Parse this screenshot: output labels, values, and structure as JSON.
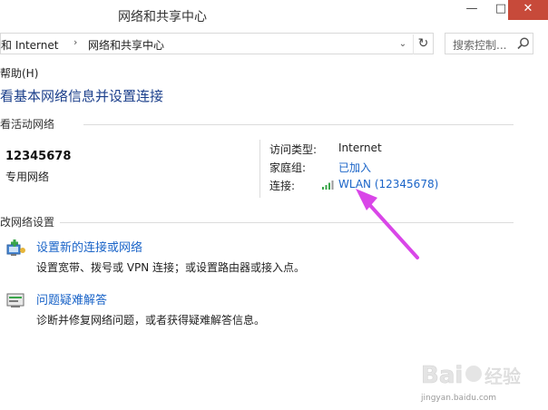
{
  "window": {
    "title": "网络和共享中心",
    "minimize": "—",
    "maximize": "□",
    "close": "✕"
  },
  "address": {
    "crumbs": [
      "和 Internet",
      "网络和共享中心"
    ],
    "separator": "›",
    "dropdown": "⌄",
    "refresh": "↻"
  },
  "search": {
    "placeholder": "搜索控制..."
  },
  "menu": {
    "help": "帮助(H)"
  },
  "heading": "看基本网络信息并设置连接",
  "active_networks": {
    "title": "看活动网络",
    "name": "12345678",
    "type": "专用网络",
    "access_type_label": "访问类型:",
    "access_type_value": "Internet",
    "homegroup_label": "家庭组:",
    "homegroup_value": "已加入",
    "connection_label": "连接:",
    "connection_value": "WLAN (12345678)"
  },
  "change_settings": {
    "title": "改网络设置",
    "tasks": [
      {
        "title": "设置新的连接或网络",
        "description": "设置宽带、拨号或 VPN 连接；或设置路由器或接入点。",
        "icon": "new-connection-icon"
      },
      {
        "title": "问题疑难解答",
        "description": "诊断并修复网络问题，或者获得疑难解答信息。",
        "icon": "troubleshoot-icon"
      }
    ]
  },
  "watermark": {
    "logo": "Baidu 经验",
    "url": "jingyan.baidu.com"
  },
  "colors": {
    "link": "#1a64c8",
    "heading": "#1b3f8b",
    "arrow": "#d946e8",
    "close": "#c74a3a"
  }
}
